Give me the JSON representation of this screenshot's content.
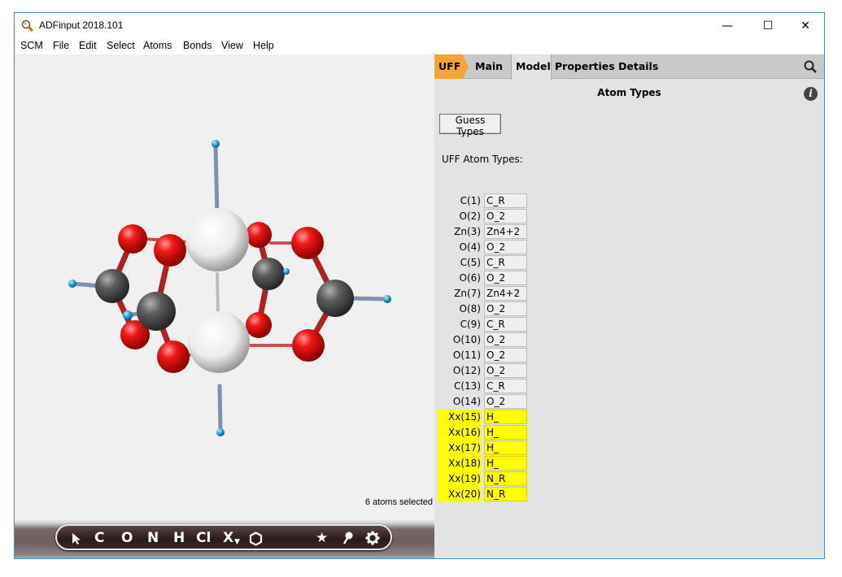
{
  "window": {
    "title": "ADFinput 2018.101",
    "minimize": "—",
    "maximize": "☐",
    "close": "✕"
  },
  "menu": [
    "SCM",
    "File",
    "Edit",
    "Select",
    "Atoms",
    "Bonds",
    "View",
    "Help"
  ],
  "viewport": {
    "status": "6 atoms selected"
  },
  "toolbar": {
    "tools": [
      "C",
      "O",
      "N",
      "H",
      "Cl",
      "X",
      "★"
    ]
  },
  "panel": {
    "tabs": {
      "uff": "UFF",
      "main": "Main",
      "model": "Model",
      "properties": "Properties",
      "details": "Details"
    },
    "active_tab": "Model",
    "title": "Atom Types",
    "guess_button": "Guess Types",
    "types_label": "UFF Atom Types:",
    "atoms": [
      {
        "label": "C(1)",
        "type": "C_R",
        "highlighted": false
      },
      {
        "label": "O(2)",
        "type": "O_2",
        "highlighted": false
      },
      {
        "label": "Zn(3)",
        "type": "Zn4+2",
        "highlighted": false
      },
      {
        "label": "O(4)",
        "type": "O_2",
        "highlighted": false
      },
      {
        "label": "C(5)",
        "type": "C_R",
        "highlighted": false
      },
      {
        "label": "O(6)",
        "type": "O_2",
        "highlighted": false
      },
      {
        "label": "Zn(7)",
        "type": "Zn4+2",
        "highlighted": false
      },
      {
        "label": "O(8)",
        "type": "O_2",
        "highlighted": false
      },
      {
        "label": "C(9)",
        "type": "C_R",
        "highlighted": false
      },
      {
        "label": "O(10)",
        "type": "O_2",
        "highlighted": false
      },
      {
        "label": "O(11)",
        "type": "O_2",
        "highlighted": false
      },
      {
        "label": "O(12)",
        "type": "O_2",
        "highlighted": false
      },
      {
        "label": "C(13)",
        "type": "C_R",
        "highlighted": false
      },
      {
        "label": "O(14)",
        "type": "O_2",
        "highlighted": false
      },
      {
        "label": "Xx(15)",
        "type": "H_",
        "highlighted": true
      },
      {
        "label": "Xx(16)",
        "type": "H_",
        "highlighted": true
      },
      {
        "label": "Xx(17)",
        "type": "H_",
        "highlighted": true
      },
      {
        "label": "Xx(18)",
        "type": "H_",
        "highlighted": true
      },
      {
        "label": "Xx(19)",
        "type": "N_R",
        "highlighted": true
      },
      {
        "label": "Xx(20)",
        "type": "N_R",
        "highlighted": true
      }
    ]
  },
  "colors": {
    "accent": "#f4a634",
    "highlight": "#ffff00",
    "oxygen": "#e8101a",
    "carbon": "#555555",
    "zinc": "#f2f2f2",
    "hydrogen": "#2fa8d8"
  }
}
